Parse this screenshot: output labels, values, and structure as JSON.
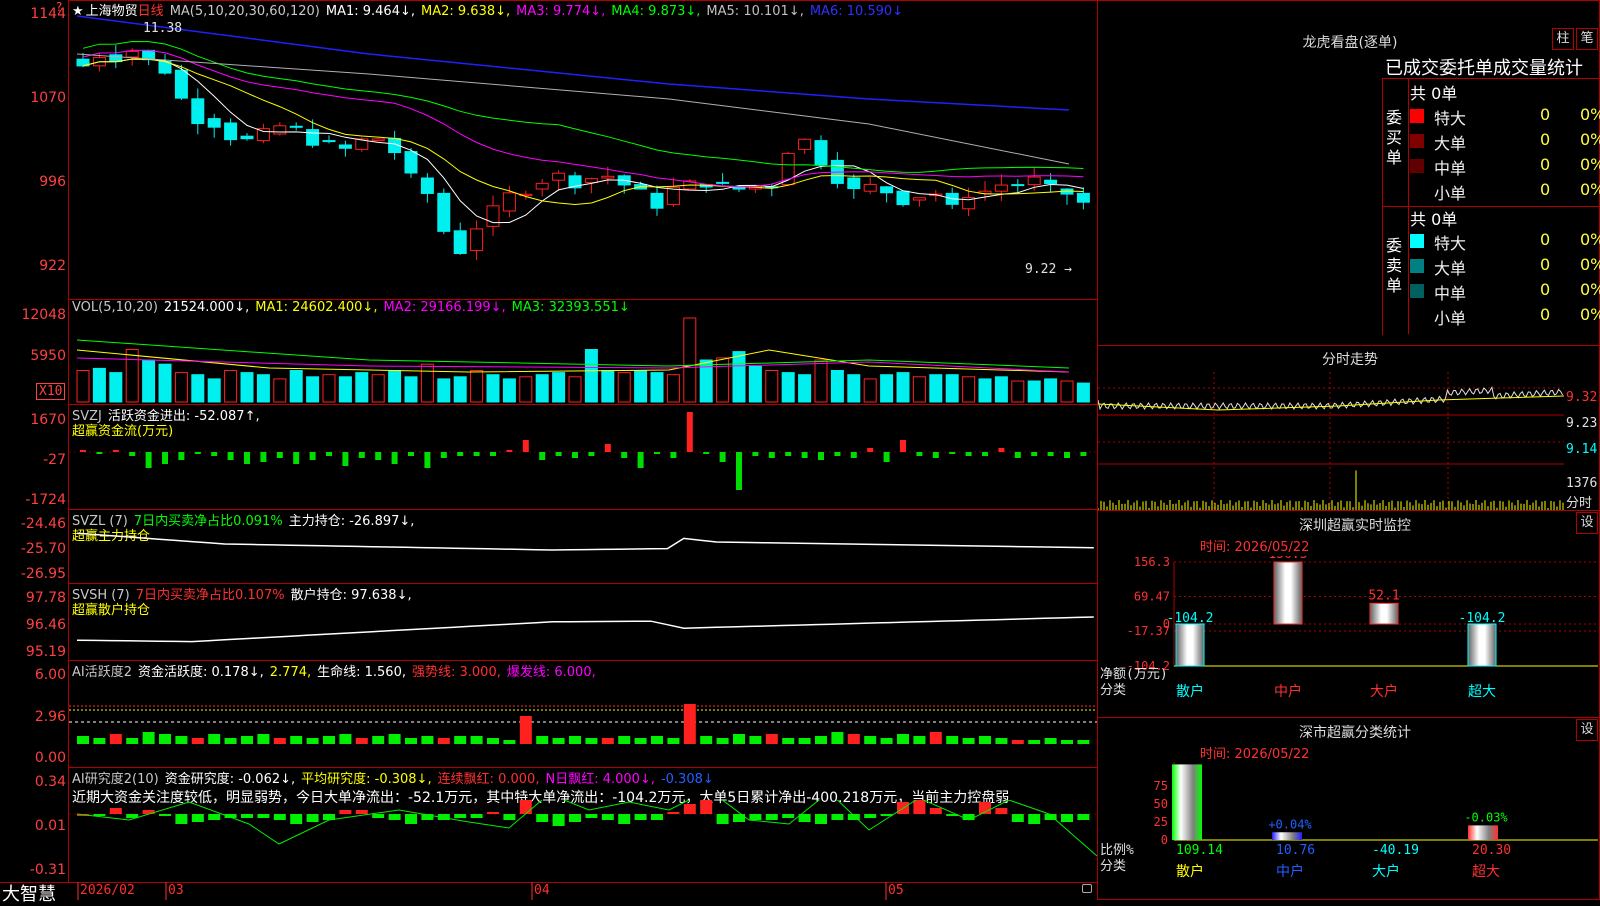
{
  "colors": {
    "up": "#ff2020",
    "down": "#00f0f0",
    "bg": "#000000",
    "grid": "#b00000",
    "ma1": "#ffffff",
    "ma2": "#ffff00",
    "ma3": "#ff00ff",
    "ma4": "#00ff00",
    "ma5": "#c0c0c0",
    "ma6": "#2020ff"
  },
  "top_left_marker": "?",
  "main": {
    "star": "★",
    "stock_name": "上海物贸",
    "period": "日线",
    "ma_title": "MA(5,10,20,30,60,120)",
    "ma1": "MA1: 9.464↓,",
    "ma2": "MA2: 9.638↓,",
    "ma3": "MA3: 9.774↓,",
    "ma4": "MA4: 9.873↓,",
    "ma5": "MA5: 10.101↓,",
    "ma6": "MA6: 10.590↓",
    "yticks": [
      "1144",
      "1070",
      "996",
      "922"
    ],
    "high_label": "11.38",
    "low_label": "9.22 →",
    "high_arrow": "↖"
  },
  "volume": {
    "title": "VOL(5,10,20)",
    "value": "21524.000↓,",
    "ma1": "MA1: 24602.400↓,",
    "ma2": "MA2: 29166.199↓,",
    "ma3": "MA3: 32393.551↓",
    "yticks": [
      "12048",
      "5950"
    ],
    "unit": "X10"
  },
  "svzj": {
    "title": "SVZJ",
    "label": "活跃资金进出: -52.087↑,",
    "subtitle": "超赢资金流(万元)",
    "yticks": [
      "1670",
      "-27",
      "-1724"
    ]
  },
  "svzl": {
    "title": "SVZL (7)",
    "ratio": "7日内买卖净占比0.091%",
    "label": "主力持仓: -26.897↓,",
    "subtitle": "超赢主力持仓",
    "yticks": [
      "-24.46",
      "-25.70",
      "-26.95"
    ]
  },
  "svsh": {
    "title": "SVSH (7)",
    "ratio": "7日内买卖净占比0.107%",
    "label": "散户持仓: 97.638↓,",
    "subtitle": "超赢散户持仓",
    "yticks": [
      "97.78",
      "96.46",
      "95.19"
    ]
  },
  "ai1": {
    "title": "AI活跃度2",
    "label1": "资金活跃度: 0.178↓,",
    "label2": "2.774,",
    "label3": "生命线: 1.560,",
    "label4": "强势线: 3.000,",
    "label5": "爆发线: 6.000,",
    "yticks": [
      "6.00",
      "2.96",
      "0.00"
    ]
  },
  "ai2": {
    "title": "AI研究度2(10)",
    "label1": "资金研究度: -0.062↓,",
    "label2": "平均研究度: -0.308↓,",
    "label3": "连续飘红: 0.000,",
    "label4": "N日飘红: 4.000↓,",
    "label5": "-0.308↓",
    "comment": "近期大资金关注度较低，明显弱势，今日大单净流出：-52.1万元，其中特大单净流出：-104.2万元，大单5日累计净出-400.218万元，当前主力控盘弱",
    "yticks": [
      "0.34",
      "0.01",
      "-0.31"
    ]
  },
  "bottom": {
    "brand": "大智慧",
    "dates": [
      "2026/02",
      "03",
      "04",
      "05"
    ]
  },
  "dragon": {
    "title": "龙虎看盘(逐单)",
    "btn1": "柱",
    "btn2": "笔",
    "header": "已成交委托单成交量统计",
    "buy_label": "委买单",
    "sell_label": "委卖单",
    "buy_total": "共 0单",
    "sell_total": "共 0单",
    "rows": [
      {
        "name": "特大",
        "count": "0",
        "pct": "0%",
        "buy_color": "#ff0000",
        "sell_color": "#00ffff"
      },
      {
        "name": "大单",
        "count": "0",
        "pct": "0%",
        "buy_color": "#800000",
        "sell_color": "#008080"
      },
      {
        "name": "中单",
        "count": "0",
        "pct": "0%",
        "buy_color": "#600000",
        "sell_color": "#006060"
      },
      {
        "name": "小单",
        "count": "0",
        "pct": "0%",
        "buy_color": "#000000",
        "sell_color": "#000000"
      }
    ]
  },
  "intraday": {
    "title": "分时走势",
    "yticks": [
      "9.32",
      "9.23",
      "9.14"
    ],
    "vol_label": "1376",
    "vol_unit": "分时"
  },
  "sz_monitor": {
    "title": "深圳超赢实时监控",
    "btn": "设",
    "time": "时间: 2026/05/22",
    "yticks": [
      "156.3",
      "69.47",
      "0",
      "-17.37",
      "-104.2"
    ],
    "axis_label1": "净额(万元)",
    "axis_label2": "分类",
    "categories": [
      "散户",
      "中户",
      "大户",
      "超大"
    ],
    "values": [
      -104.2,
      156.3,
      52.1,
      -104.2
    ],
    "value_labels": [
      "-104.2",
      "156.3",
      "52.1",
      "-104.2"
    ]
  },
  "sz_class": {
    "title": "深市超赢分类统计",
    "btn": "设",
    "time": "时间: 2026/05/22",
    "yticks": [
      "75",
      "50",
      "25",
      "0"
    ],
    "axis_label1": "比例%",
    "axis_label2": "分类",
    "categories": [
      "散户",
      "中户",
      "大户",
      "超大"
    ],
    "values": [
      109.14,
      10.76,
      -40.19,
      20.3
    ],
    "change_labels": [
      "",
      "+0.04%",
      "",
      "-0.03%"
    ],
    "value_labels": [
      "109.14",
      "10.76",
      "-40.19",
      "20.30"
    ]
  }
}
